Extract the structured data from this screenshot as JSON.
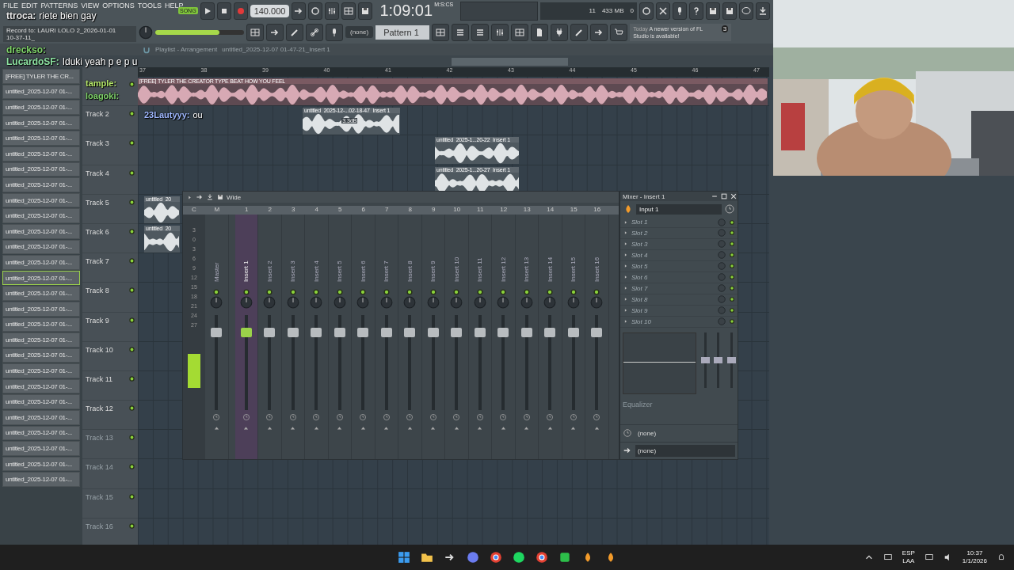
{
  "menu": [
    "FILE",
    "EDIT",
    "PATTERNS",
    "VIEW",
    "OPTIONS",
    "TOOLS",
    "HELP"
  ],
  "master_volume": {
    "level": 0.72
  },
  "transport": {
    "mode": "SONG",
    "tempo": "140.000",
    "time": "1:09:01",
    "time_unit": "M:S:CS",
    "cpu": "11",
    "memory": "433 MB",
    "polyphony": "0",
    "playing": false
  },
  "record_hint": [
    "Record to: LAURI LOLO 2_2026-01-01",
    "10-37-11_"
  ],
  "pattern": {
    "preset": "(none)",
    "name": "Pattern 1"
  },
  "news": {
    "date": "Today",
    "text": "A newer version of FL Studio is available!",
    "badge": "3"
  },
  "playlist": {
    "title": "Playlist - Arrangement",
    "clip": "untitled_2025-12-07 01-47-21_Insert 1",
    "ruler": [
      "37",
      "38",
      "39",
      "40",
      "41",
      "42",
      "43",
      "44",
      "45",
      "46",
      "47"
    ],
    "tracks": [
      {
        "label": "Track 2",
        "active": true
      },
      {
        "label": "Track 3",
        "active": true
      },
      {
        "label": "Track 4",
        "active": true
      },
      {
        "label": "Track 5",
        "active": true
      },
      {
        "label": "Track 6",
        "active": true
      },
      {
        "label": "Track 7",
        "active": true
      },
      {
        "label": "Track 8",
        "active": true
      },
      {
        "label": "Track 9",
        "active": true
      },
      {
        "label": "Track 10",
        "active": true
      },
      {
        "label": "Track 11",
        "active": true
      },
      {
        "label": "Track 12",
        "active": true
      },
      {
        "label": "Track 13",
        "active": false
      },
      {
        "label": "Track 14",
        "active": false
      },
      {
        "label": "Track 15",
        "active": false
      },
      {
        "label": "Track 16",
        "active": false
      }
    ],
    "clips": [
      {
        "title": "[FREE] TYLER THE CREATOR TYPE BEAT HOW YOU FEEL",
        "kind": "audio"
      },
      {
        "title": "untitled_2025-12-...02-18-47_Insert 1",
        "kind": "audio",
        "note": "3.3dB"
      },
      {
        "title": "untitled_2025-1...20-22_Insert 1",
        "kind": "audio"
      },
      {
        "title": "untitled_2025-1...20-27_Insert 1",
        "kind": "audio"
      },
      {
        "title": "untitled_20",
        "kind": "audio"
      },
      {
        "title": "untitled_20",
        "kind": "audio"
      }
    ]
  },
  "browser": [
    {
      "label": "[FREE] TYLER THE CR...",
      "selected": false
    },
    {
      "label": "untitled_2025-12-07 01-...",
      "selected": false
    },
    {
      "label": "untitled_2025-12-07 01-...",
      "selected": false
    },
    {
      "label": "untitled_2025-12-07 01-...",
      "selected": false
    },
    {
      "label": "untitled_2025-12-07 01-...",
      "selected": false
    },
    {
      "label": "untitled_2025-12-07 01-...",
      "selected": false
    },
    {
      "label": "untitled_2025-12-07 01-...",
      "selected": false
    },
    {
      "label": "untitled_2025-12-07 01-...",
      "selected": false
    },
    {
      "label": "untitled_2025-12-07 01-...",
      "selected": false
    },
    {
      "label": "untitled_2025-12-07 01-...",
      "selected": false
    },
    {
      "label": "untitled_2025-12-07 01-...",
      "selected": false
    },
    {
      "label": "untitled_2025-12-07 01-...",
      "selected": false
    },
    {
      "label": "untitled_2025-12-07 01-...",
      "selected": false
    },
    {
      "label": "untitled_2025-12-07 01-...",
      "selected": true
    },
    {
      "label": "untitled_2025-12-07 01-...",
      "selected": false
    },
    {
      "label": "untitled_2025-12-07 01-...",
      "selected": false
    },
    {
      "label": "untitled_2025-12-07 01-...",
      "selected": false
    },
    {
      "label": "untitled_2025-12-07 01-...",
      "selected": false
    },
    {
      "label": "untitled_2025-12-07 01-...",
      "selected": false
    },
    {
      "label": "untitled_2025-12-07 01-...",
      "selected": false
    },
    {
      "label": "untitled_2025-12-07 01-...",
      "selected": false
    },
    {
      "label": "untitled_2025-12-07 01-...",
      "selected": false
    },
    {
      "label": "untitled_2025-12-07 01-...",
      "selected": false
    },
    {
      "label": "untitled_2025-12-07 01-...",
      "selected": false
    },
    {
      "label": "untitled_2025-12-07 01-...",
      "selected": false
    },
    {
      "label": "untitled_2025-12-07 01-...",
      "selected": false
    },
    {
      "label": "untitled_2025-12-07 01-...",
      "selected": false
    }
  ],
  "mixer": {
    "preset": "Wide",
    "scale": [
      "3",
      "0",
      "3",
      "6",
      "9",
      "12",
      "15",
      "18",
      "21",
      "24",
      "27"
    ],
    "header": [
      "C",
      "M"
    ],
    "strips": [
      {
        "name": "Master",
        "selected": false,
        "level": 0.82
      },
      {
        "number": "1",
        "name": "Insert 1",
        "selected": true,
        "level": 0.82
      },
      {
        "number": "2",
        "name": "Insert 2",
        "selected": false,
        "level": 0.82
      },
      {
        "number": "3",
        "name": "Insert 3",
        "selected": false,
        "level": 0.82
      },
      {
        "number": "4",
        "name": "Insert 4",
        "selected": false,
        "level": 0.82
      },
      {
        "number": "5",
        "name": "Insert 5",
        "selected": false,
        "level": 0.82
      },
      {
        "number": "6",
        "name": "Insert 6",
        "selected": false,
        "level": 0.82
      },
      {
        "number": "7",
        "name": "Insert 7",
        "selected": false,
        "level": 0.82
      },
      {
        "number": "8",
        "name": "Insert 8",
        "selected": false,
        "level": 0.82
      },
      {
        "number": "9",
        "name": "Insert 9",
        "selected": false,
        "level": 0.82
      },
      {
        "number": "10",
        "name": "Insert 10",
        "selected": false,
        "level": 0.82
      },
      {
        "number": "11",
        "name": "Insert 11",
        "selected": false,
        "level": 0.82
      },
      {
        "number": "12",
        "name": "Insert 12",
        "selected": false,
        "level": 0.82
      },
      {
        "number": "13",
        "name": "Insert 13",
        "selected": false,
        "level": 0.82
      },
      {
        "number": "14",
        "name": "Insert 14",
        "selected": false,
        "level": 0.82
      },
      {
        "number": "15",
        "name": "Insert 15",
        "selected": false,
        "level": 0.82
      },
      {
        "number": "16",
        "name": "Insert 16",
        "selected": false,
        "level": 0.82
      }
    ]
  },
  "insert_panel": {
    "title": "Mixer - Insert 1",
    "input": "Input 1",
    "slots": [
      "Slot 1",
      "Slot 2",
      "Slot 3",
      "Slot 4",
      "Slot 5",
      "Slot 6",
      "Slot 7",
      "Slot 8",
      "Slot 9",
      "Slot 10"
    ],
    "eq_label": "Equalizer",
    "eq_levels": [
      {
        "level": 0.5
      },
      {
        "level": 0.5
      },
      {
        "level": 0.5
      }
    ],
    "send": "(none)",
    "output": "(none)"
  },
  "chat": [
    {
      "user": "ttroca:",
      "text": "riete bien gay",
      "color": "#e8e8e8"
    },
    {
      "user": "dreckso:",
      "color": "#7fd36a"
    },
    {
      "user": "LucardoSF:",
      "text": "Iduki yeah p e p u",
      "color": "#8ce0a0"
    },
    {
      "user": "tample:",
      "color": "#b6e86a"
    },
    {
      "user": "loagoki:",
      "color": "#7fd36a"
    },
    {
      "user": "23Lautyyy:",
      "text": "ou",
      "color": "#9fb8ff"
    }
  ],
  "webcam": {
    "kind": "picture"
  },
  "taskbar": {
    "language": [
      "ESP",
      "LAA"
    ],
    "time": "10:37",
    "date": "1/1/2026"
  }
}
